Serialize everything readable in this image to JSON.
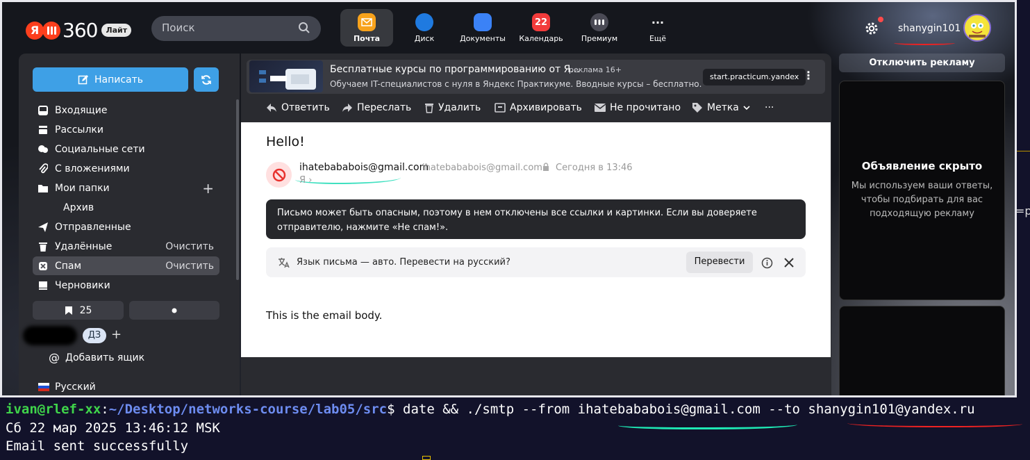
{
  "header": {
    "logo_number": "360",
    "logo_badge": "Лайт",
    "search_placeholder": "Поиск",
    "username": "shanygin101",
    "apps": [
      {
        "label": "Почта",
        "color": "#f7a21b"
      },
      {
        "label": "Диск",
        "color": "#1f7ae0"
      },
      {
        "label": "Документы",
        "color": "#3b82f6"
      },
      {
        "label": "Календарь",
        "badge": "22",
        "color": "#f23b3b"
      },
      {
        "label": "Премиум",
        "color": "#4a4a55"
      },
      {
        "label": "Ещё",
        "color": "transparent"
      }
    ]
  },
  "sidebar": {
    "compose": "Написать",
    "folders": [
      {
        "label": "Входящие"
      },
      {
        "label": "Рассылки"
      },
      {
        "label": "Социальные сети"
      },
      {
        "label": "С вложениями"
      },
      {
        "label": "Мои папки",
        "right": "+"
      },
      {
        "label": "Архив"
      },
      {
        "label": "Отправленные"
      },
      {
        "label": "Удалённые",
        "right": "Очистить"
      },
      {
        "label": "Спам",
        "right": "Очистить"
      },
      {
        "label": "Черновики"
      }
    ],
    "bookmark_count": "25",
    "mailbox_tag": "ДЗ",
    "add_mailbox": "Добавить ящик",
    "language": "Русский"
  },
  "ad": {
    "title": "Бесплатные курсы по программированию от Я...",
    "tag": "реклама  16+",
    "subtitle": "Обучаем IT-специалистов с нуля в Яндекс Практикуме. Вводные курсы – бесплатно.",
    "domain": "start.practicum.yandex"
  },
  "toolbar": {
    "reply": "Ответить",
    "forward": "Переслать",
    "delete": "Удалить",
    "archive": "Архивировать",
    "unread": "Не прочитано",
    "label": "Метка",
    "more": "···"
  },
  "message": {
    "subject": "Hello!",
    "from_name": "ihatebababois@gmail.com",
    "from_address": "ihatebababois@gmail.com",
    "date": "Сегодня в 13:46",
    "to": "Я",
    "warning": "Письмо может быть опасным, поэтому в нем отключены все ссылки и картинки. Если вы доверяете отправителю, нажмите «Не спам!».",
    "translate_text": "Язык письма — авто. Перевести на русский?",
    "translate_button": "Перевести",
    "body": "This is the email body."
  },
  "right_ads": {
    "disable": "Отключить рекламу",
    "hidden_title": "Объявление скрыто",
    "hidden_text": "Мы используем ваши ответы, чтобы подбирать для вас подходящую рекламу"
  },
  "terminal": {
    "user": "ivan@rlef-xx",
    "path": "~/Desktop/networks-course/lab05/src",
    "command": "date && ./smtp --from ihatebababois@gmail.com --to shanygin101@yandex.ru",
    "line2": "Сб 22 мар 2025 13:46:12 MSK",
    "line3": "Email sent successfully"
  },
  "edge_text": "=p"
}
